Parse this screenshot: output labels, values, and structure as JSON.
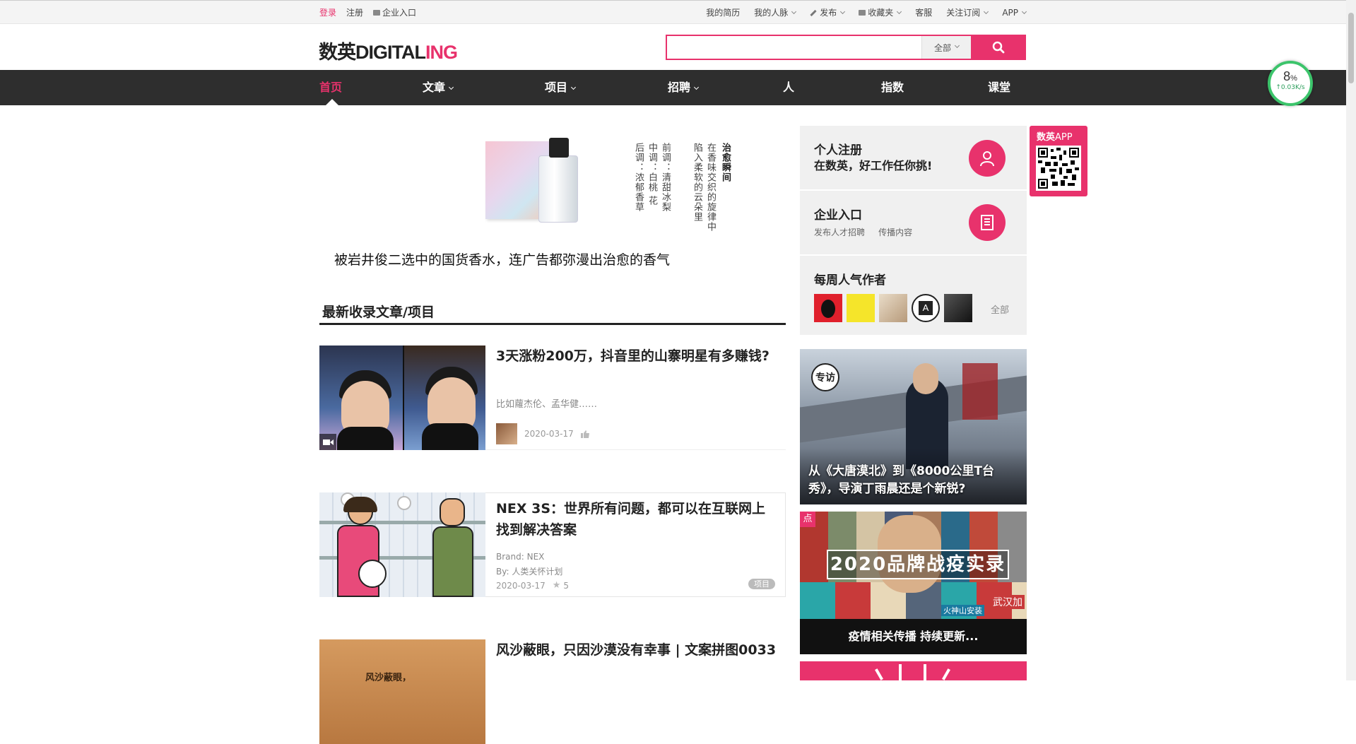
{
  "topbar": {
    "login": "登录",
    "register": "注册",
    "enterprise": "企业入口",
    "right": [
      "我的简历",
      "我的人脉",
      "发布",
      "收藏夹",
      "客服",
      "关注订阅",
      "APP"
    ]
  },
  "header": {
    "logo_cn": "数英",
    "logo_en_a": "DIGITAL",
    "logo_en_b": "ING",
    "search_scope": "全部"
  },
  "nav": [
    "首页",
    "文章",
    "项目",
    "招聘",
    "人",
    "指数",
    "课堂"
  ],
  "speed": {
    "value": "8",
    "unit": "%",
    "rate": "↑0.03K/s"
  },
  "banner": {
    "title": "被岩井俊二选中的国货香水，连广告都弥漫出治愈的香气",
    "col1": "治愈瞬间",
    "col2": "在香味交织的旋律中",
    "col3": "陷入柔软的云朵里",
    "col4": "前调：清甜冰梨",
    "col5": "中调：白桃 花",
    "col6": "后调：浓郁香草"
  },
  "section_title": "最新收录文章/项目",
  "articles": [
    {
      "title": "3天涨粉200万，抖音里的山寨明星有多赚钱?",
      "desc": "比如蘿杰伦、孟华健……",
      "date": "2020-03-17"
    },
    {
      "title": "NEX 3S：世界所有问题，都可以在互联网上找到解决答案",
      "brand": "Brand: NEX",
      "by": "By: 人类关怀计划",
      "date": "2020-03-17",
      "likes": "5",
      "tag": "项目"
    },
    {
      "title": "风沙蔽眼，只因沙漠没有幸事 | 文案拼图0033",
      "thumb_text": "风沙蔽眼，"
    }
  ],
  "side": {
    "register_title": "个人注册",
    "register_sub": "在数英，好工作任你挑!",
    "enterprise_title": "企业入口",
    "enterprise_sub": "发布人才招聘     传播内容",
    "authors_title": "每周人气作者",
    "all": "全部",
    "qr_label_a": "数英",
    "qr_label_b": "APP",
    "promo1_badge": "专访",
    "promo1_caption": "从《大唐漠北》到《8000公里T台秀》，导演丁雨晨还是个新锐?",
    "promo2_badge": "点",
    "promo2_title": "2020品牌战疫实录",
    "promo2_caption": "疫情相关传播 持续更新...",
    "promo2_extra1": "火神山安装",
    "promo2_extra2": "武汉加"
  }
}
